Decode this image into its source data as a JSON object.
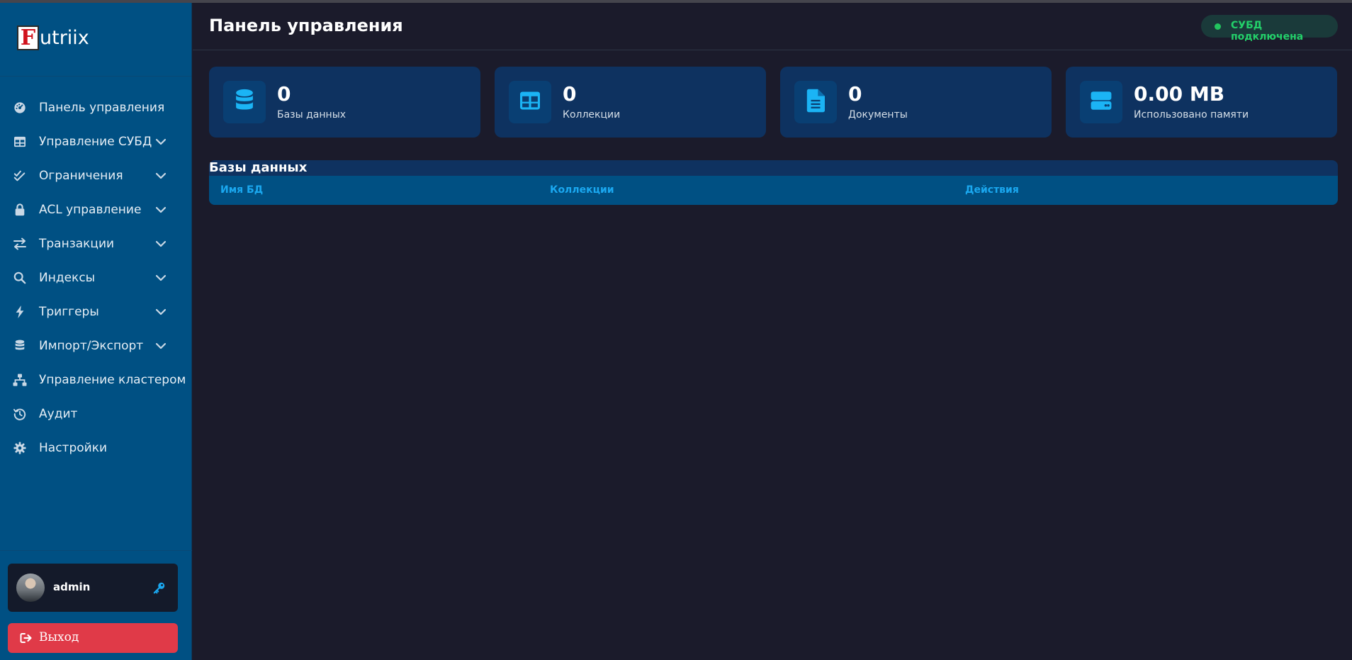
{
  "app": {
    "logo_letter": "F",
    "logo_text": "utriix"
  },
  "sidebar": {
    "items": [
      {
        "label": "Панель управления",
        "icon": "dashboard-gauge-icon",
        "expandable": false
      },
      {
        "label": "Управление СУБД",
        "icon": "table-grid-icon",
        "expandable": true
      },
      {
        "label": "Ограничения",
        "icon": "check-double-icon",
        "expandable": true
      },
      {
        "label": "ACL управление",
        "icon": "lock-icon",
        "expandable": true
      },
      {
        "label": "Транзакции",
        "icon": "exchange-arrows-icon",
        "expandable": true
      },
      {
        "label": "Индексы",
        "icon": "search-icon",
        "expandable": true
      },
      {
        "label": "Триггеры",
        "icon": "bolt-icon",
        "expandable": true
      },
      {
        "label": "Импорт/Экспорт",
        "icon": "database-icon",
        "expandable": true
      },
      {
        "label": "Управление кластером",
        "icon": "sitemap-icon",
        "expandable": false
      },
      {
        "label": "Аудит",
        "icon": "history-icon",
        "expandable": false
      },
      {
        "label": "Настройки",
        "icon": "gear-icon",
        "expandable": false
      }
    ]
  },
  "user": {
    "name": "admin",
    "logout_label": "Выход"
  },
  "header": {
    "title": "Панель управления",
    "status": "СУБД подключена"
  },
  "stats": [
    {
      "value": "0",
      "label": "Базы данных",
      "icon": "database-icon"
    },
    {
      "value": "0",
      "label": "Коллекции",
      "icon": "table-grid-icon"
    },
    {
      "value": "0",
      "label": "Документы",
      "icon": "file-text-icon"
    },
    {
      "value": "0.00 MB",
      "label": "Использовано памяти",
      "icon": "hard-drive-icon"
    }
  ],
  "databases": {
    "title": "Базы данных",
    "columns": [
      "Имя БД",
      "Коллекции",
      "Действия"
    ]
  },
  "colors": {
    "sidebar_bg": "#005083",
    "main_bg": "#1b1b2b",
    "card_bg": "#0e3260",
    "accent": "#1aa8f0",
    "status_green": "#23d16a",
    "logout_red": "#e03a48"
  }
}
